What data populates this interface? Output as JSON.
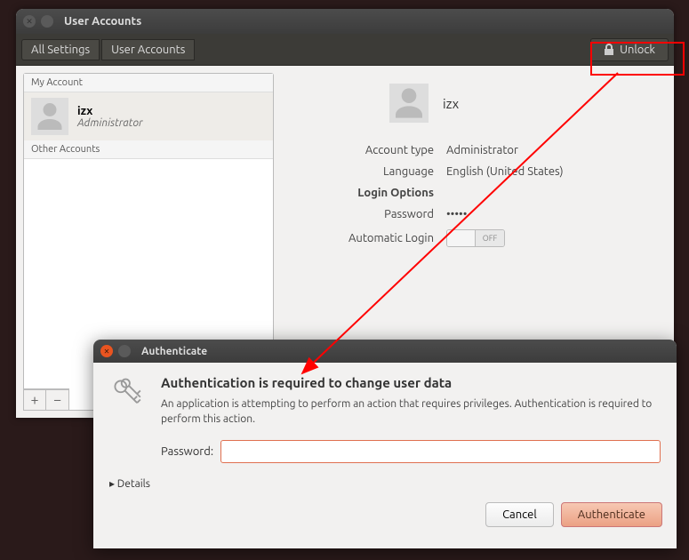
{
  "main": {
    "title": "User Accounts",
    "breadcrumbs": [
      "All Settings",
      "User Accounts"
    ],
    "unlock_label": "Unlock"
  },
  "sidebar": {
    "my_account_header": "My Account",
    "other_accounts_header": "Other Accounts",
    "users": [
      {
        "name": "izx",
        "role": "Administrator"
      }
    ],
    "add_label": "+",
    "remove_label": "−"
  },
  "details": {
    "user_name": "izx",
    "account_type_label": "Account type",
    "account_type_value": "Administrator",
    "language_label": "Language",
    "language_value": "English (United States)",
    "login_options_label": "Login Options",
    "password_label": "Password",
    "password_value": "•••••",
    "auto_login_label": "Automatic Login",
    "auto_login_state": "OFF"
  },
  "auth": {
    "title": "Authenticate",
    "heading": "Authentication is required to change user data",
    "description": "An application is attempting to perform an action that requires privileges. Authentication is required to perform this action.",
    "password_label": "Password:",
    "details_label": "Details",
    "cancel_label": "Cancel",
    "authenticate_label": "Authenticate"
  }
}
